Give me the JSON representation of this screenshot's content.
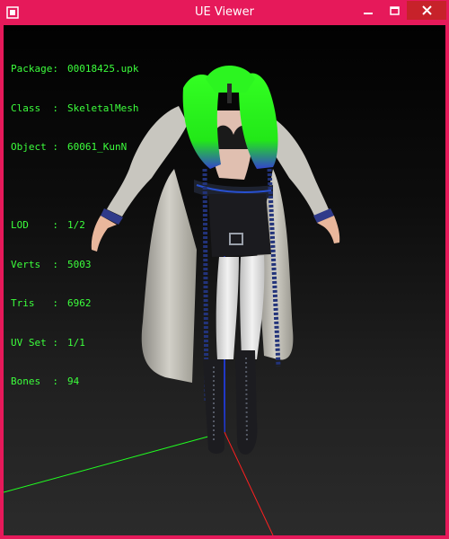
{
  "window": {
    "title": "UE Viewer"
  },
  "info": {
    "package": {
      "label": "Package:",
      "value": "00018425.upk"
    },
    "class": {
      "label": "Class  :",
      "value": "SkeletalMesh"
    },
    "object": {
      "label": "Object :",
      "value": "60061_KunN"
    },
    "lod": {
      "label": "LOD    :",
      "value": "1/2"
    },
    "verts": {
      "label": "Verts  :",
      "value": "5003"
    },
    "tris": {
      "label": "Tris   :",
      "value": "6962"
    },
    "uvset": {
      "label": "UV Set :",
      "value": "1/1"
    },
    "bones": {
      "label": "Bones  :",
      "value": "94"
    }
  },
  "colors": {
    "frame": "#e6195a",
    "close_button": "#c7222a",
    "info_text": "#3cff3c",
    "axis_x": "#ff2020",
    "axis_y": "#20ff20",
    "axis_z": "#2040ff"
  },
  "icons": [
    "app-icon",
    "minimize-icon",
    "maximize-icon",
    "close-icon"
  ]
}
